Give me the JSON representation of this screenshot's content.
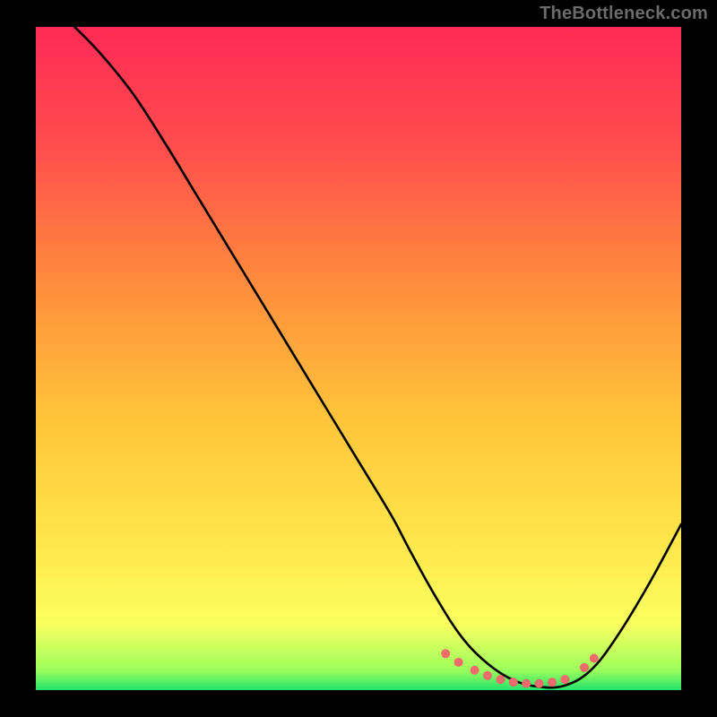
{
  "watermark": "TheBottleneck.com",
  "chart_data": {
    "type": "line",
    "title": "",
    "xlabel": "",
    "ylabel": "",
    "xlim": [
      0,
      100
    ],
    "ylim": [
      0,
      100
    ],
    "grid": false,
    "legend": false,
    "gradient_stops": [
      {
        "offset": 0.0,
        "color": "#ff2a55"
      },
      {
        "offset": 0.18,
        "color": "#ff4d4d"
      },
      {
        "offset": 0.38,
        "color": "#ff8a3d"
      },
      {
        "offset": 0.58,
        "color": "#ffc23a"
      },
      {
        "offset": 0.78,
        "color": "#ffe74a"
      },
      {
        "offset": 0.9,
        "color": "#fbff60"
      },
      {
        "offset": 0.97,
        "color": "#9cff5c"
      },
      {
        "offset": 1.0,
        "color": "#22e36b"
      }
    ],
    "series": [
      {
        "name": "curve",
        "color": "#000000",
        "x": [
          6,
          10,
          15,
          20,
          25,
          30,
          35,
          40,
          45,
          50,
          55,
          58,
          62,
          66,
          70,
          74,
          78,
          82,
          86,
          90,
          95,
          100
        ],
        "y": [
          100,
          96,
          90,
          82.5,
          74.5,
          66.5,
          58.5,
          50.5,
          42.5,
          34.5,
          26.5,
          21,
          14,
          8,
          4,
          1.5,
          0.5,
          0.7,
          3,
          8,
          16,
          25
        ]
      }
    ],
    "markers": {
      "color": "#ef6a6a",
      "radius": 5,
      "points": [
        {
          "x": 63.5,
          "y": 5.5
        },
        {
          "x": 65.5,
          "y": 4.2
        },
        {
          "x": 68.0,
          "y": 3.0
        },
        {
          "x": 70.0,
          "y": 2.2
        },
        {
          "x": 72.0,
          "y": 1.6
        },
        {
          "x": 74.0,
          "y": 1.2
        },
        {
          "x": 76.0,
          "y": 1.0
        },
        {
          "x": 78.0,
          "y": 1.0
        },
        {
          "x": 80.0,
          "y": 1.2
        },
        {
          "x": 82.0,
          "y": 1.6
        },
        {
          "x": 85.0,
          "y": 3.4
        },
        {
          "x": 86.5,
          "y": 4.8
        }
      ]
    }
  }
}
